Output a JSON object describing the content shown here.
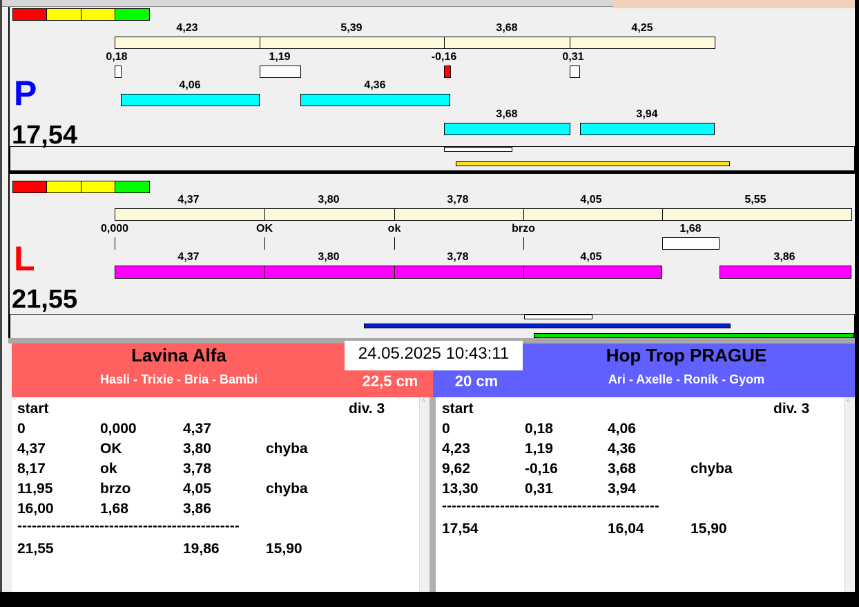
{
  "colors": {
    "red": "#ff0000",
    "yellow": "#ffff00",
    "green": "#00ff00",
    "team_left": "#ff6060",
    "team_right": "#6060ff"
  },
  "p_panel": {
    "letter": "P",
    "total": "17,54",
    "seg_labels": [
      "4,23",
      "5,39",
      "3,68",
      "4,25"
    ],
    "small_labels": [
      "0,18",
      "1,19",
      "-0,16",
      "0,31"
    ],
    "run_row1": [
      "4,06",
      "4,36"
    ],
    "run_row2": [
      "3,68",
      "3,94"
    ]
  },
  "l_panel": {
    "letter": "L",
    "total": "21,55",
    "seg_labels": [
      "4,37",
      "3,80",
      "3,78",
      "4,05",
      "5,55"
    ],
    "small_labels": [
      "0,000",
      "OK",
      "ok",
      "brzo",
      "1,68"
    ],
    "run_labels": [
      "4,37",
      "3,80",
      "3,78",
      "4,05",
      "3,86"
    ]
  },
  "timestamp": "24.05.2025 10:43:11",
  "left_team": {
    "name": "Lavina Alfa",
    "dogs": "Hasli - Trixie - Bria - Bambi",
    "height": "22,5 cm",
    "start": "start",
    "div": "div.  3",
    "rows": [
      [
        "0",
        "0,000",
        "4,37",
        ""
      ],
      [
        "4,37",
        "OK",
        "3,80",
        "chyba"
      ],
      [
        "8,17",
        "ok",
        "3,78",
        ""
      ],
      [
        "11,95",
        "brzo",
        "4,05",
        "chyba"
      ],
      [
        "16,00",
        "1,68",
        "3,86",
        ""
      ]
    ],
    "separator": "----------------------------------------------",
    "total": [
      "21,55",
      "",
      "19,86",
      "15,90"
    ]
  },
  "right_team": {
    "name": "Hop Trop PRAGUE",
    "dogs": "Ari - Axelle - Roník - Gyom",
    "height": "20 cm",
    "start": "start",
    "div": "div.  3",
    "rows": [
      [
        "0",
        "0,18",
        "4,06",
        ""
      ],
      [
        "4,23",
        "1,19",
        "4,36",
        ""
      ],
      [
        "9,62",
        "-0,16",
        "3,68",
        "chyba"
      ],
      [
        "13,30",
        "0,31",
        "3,94",
        ""
      ]
    ],
    "separator": "---------------------------------------------",
    "total": [
      "17,54",
      "",
      "16,04",
      "15,90"
    ]
  }
}
